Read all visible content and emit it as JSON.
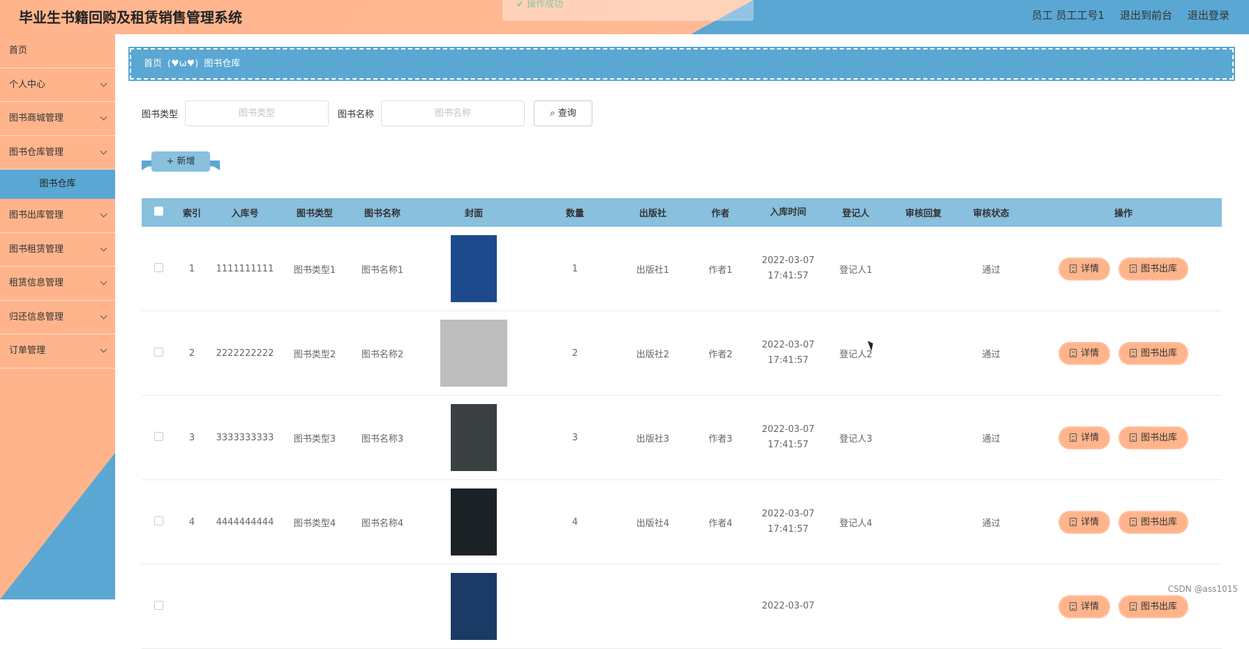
{
  "header": {
    "title": "毕业生书籍回购及租赁销售管理系统",
    "toast": "操作成功",
    "user": "员工 员工工号1",
    "front": "退出到前台",
    "logout": "退出登录"
  },
  "sidebar": {
    "items": [
      {
        "label": "首页",
        "expandable": false
      },
      {
        "label": "个人中心",
        "expandable": true
      },
      {
        "label": "图书商城管理",
        "expandable": true
      },
      {
        "label": "图书仓库管理",
        "expandable": true
      },
      {
        "label": "图书出库管理",
        "expandable": true
      },
      {
        "label": "图书租赁管理",
        "expandable": true
      },
      {
        "label": "租赁信息管理",
        "expandable": true
      },
      {
        "label": "归还信息管理",
        "expandable": true
      },
      {
        "label": "订单管理",
        "expandable": true
      }
    ],
    "active_sub": "图书仓库"
  },
  "breadcrumb": {
    "home": "首页",
    "sep": "(♥ω♥)",
    "current": "图书仓库"
  },
  "search": {
    "type_label": "图书类型",
    "type_placeholder": "图书类型",
    "name_label": "图书名称",
    "name_placeholder": "图书名称",
    "query_label": "查询"
  },
  "add_label": "新增",
  "table": {
    "headers": {
      "idx": "索引",
      "no": "入库号",
      "type": "图书类型",
      "name": "图书名称",
      "cover": "封面",
      "qty": "数量",
      "pub": "出版社",
      "auth": "作者",
      "time": "入库时间",
      "reg": "登记人",
      "rep": "审核回复",
      "stat": "审核状态",
      "op": "操作"
    },
    "rows": [
      {
        "idx": "1",
        "no": "1111111111",
        "type": "图书类型1",
        "name": "图书名称1",
        "qty": "1",
        "pub": "出版社1",
        "auth": "作者1",
        "date": "2022-03-07",
        "time": "17:41:57",
        "reg": "登记人1",
        "rep": "",
        "stat": "通过",
        "cover_color": "#1d4a8c"
      },
      {
        "idx": "2",
        "no": "2222222222",
        "type": "图书类型2",
        "name": "图书名称2",
        "qty": "2",
        "pub": "出版社2",
        "auth": "作者2",
        "date": "2022-03-07",
        "time": "17:41:57",
        "reg": "登记人2",
        "rep": "",
        "stat": "通过",
        "cover_color": "#bdbdbd"
      },
      {
        "idx": "3",
        "no": "3333333333",
        "type": "图书类型3",
        "name": "图书名称3",
        "qty": "3",
        "pub": "出版社3",
        "auth": "作者3",
        "date": "2022-03-07",
        "time": "17:41:57",
        "reg": "登记人3",
        "rep": "",
        "stat": "通过",
        "cover_color": "#3a3f42"
      },
      {
        "idx": "4",
        "no": "4444444444",
        "type": "图书类型4",
        "name": "图书名称4",
        "qty": "4",
        "pub": "出版社4",
        "auth": "作者4",
        "date": "2022-03-07",
        "time": "17:41:57",
        "reg": "登记人4",
        "rep": "",
        "stat": "通过",
        "cover_color": "#1a2226"
      },
      {
        "idx": "",
        "no": "",
        "type": "",
        "name": "",
        "qty": "",
        "pub": "",
        "auth": "",
        "date": "2022-03-07",
        "time": "",
        "reg": "",
        "rep": "",
        "stat": "",
        "cover_color": "#1b3b66"
      }
    ],
    "btn_detail": "详情",
    "btn_out": "图书出库"
  },
  "watermark": "CSDN @ass1015"
}
